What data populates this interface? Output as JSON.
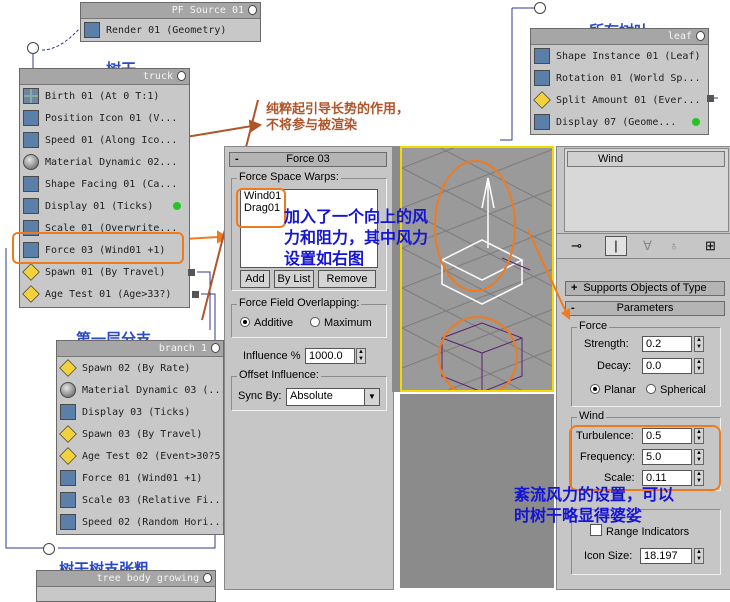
{
  "pf_source": {
    "header": "PF Source 01",
    "ops": [
      "Render 01 (Geometry)"
    ]
  },
  "truck": {
    "title": "树干",
    "header": "truck",
    "ops": [
      {
        "icon": "birth-icon",
        "label": "Birth 01 (At 0 T:1)"
      },
      {
        "icon": "position-icon",
        "label": "Position Icon 01 (V..."
      },
      {
        "icon": "speed-icon",
        "label": "Speed 01 (Along Ico..."
      },
      {
        "icon": "material-icon",
        "label": "Material Dynamic 02..."
      },
      {
        "icon": "shape-facing-icon",
        "label": "Shape Facing 01 (Ca..."
      },
      {
        "icon": "display-icon",
        "label": "Display 01 (Ticks)"
      },
      {
        "icon": "scale-icon",
        "label": "Scale 01 (Overwrite..."
      },
      {
        "icon": "force-icon",
        "label": "Force 03 (Wind01 +1)"
      },
      {
        "icon": "spawn-icon",
        "label": "Spawn 01 (By Travel)"
      },
      {
        "icon": "age-test-icon",
        "label": "Age Test 01 (Age>33?)"
      }
    ]
  },
  "leaf": {
    "title": "所有树叶",
    "header": "leaf",
    "ops": [
      {
        "icon": "shape-instance-icon",
        "label": "Shape Instance 01 (Leaf)"
      },
      {
        "icon": "rotation-icon",
        "label": "Rotation 01 (World Sp..."
      },
      {
        "icon": "split-amount-icon",
        "label": "Split Amount 01 (Ever..."
      },
      {
        "icon": "display-icon",
        "label": "Display 07 (Geome..."
      }
    ]
  },
  "branch": {
    "title": "第一层分支",
    "header": "branch 1",
    "ops": [
      {
        "icon": "spawn-icon",
        "label": "Spawn 02 (By Rate)"
      },
      {
        "icon": "material-icon",
        "label": "Material Dynamic 03 (..."
      },
      {
        "icon": "display-icon",
        "label": "Display 03 (Ticks)"
      },
      {
        "icon": "spawn-icon",
        "label": "Spawn 03 (By Travel)"
      },
      {
        "icon": "age-test-icon",
        "label": "Age Test 02 (Event>30?5..."
      },
      {
        "icon": "force-icon",
        "label": "Force 01 (Wind01 +1)"
      },
      {
        "icon": "scale-icon",
        "label": "Scale 03 (Relative Fi..."
      },
      {
        "icon": "speed-icon",
        "label": "Speed 02 (Random Hori..."
      }
    ]
  },
  "tree_body": {
    "title": "树干树支张粗",
    "header": "tree body growing"
  },
  "force_panel": {
    "title": "Force 03",
    "group_warps": "Force Space Warps:",
    "warps": [
      "Wind01",
      "Drag01"
    ],
    "btn_add": "Add",
    "btn_by_list": "By List",
    "btn_remove": "Remove",
    "group_overlap": "Force Field Overlapping:",
    "opt_additive": "Additive",
    "opt_maximum": "Maximum",
    "influence_label": "Influence %",
    "influence_value": "1000.0",
    "group_offset": "Offset Influence:",
    "sync_label": "Sync By:",
    "sync_value": "Absolute"
  },
  "wind_panel": {
    "name": "Wind",
    "roll_supports": "Supports Objects of Type",
    "roll_params": "Parameters",
    "group_force": "Force",
    "strength_label": "Strength:",
    "strength_value": "0.2",
    "decay_label": "Decay:",
    "decay_value": "0.0",
    "opt_planar": "Planar",
    "opt_spherical": "Spherical",
    "group_wind": "Wind",
    "turbulence_label": "Turbulence:",
    "turbulence_value": "0.5",
    "frequency_label": "Frequency:",
    "frequency_value": "5.0",
    "scale_label": "Scale:",
    "scale_value": "0.11",
    "range_label": "Range Indicators",
    "icon_size_label": "Icon Size:",
    "icon_size_value": "18.197"
  },
  "annotations": {
    "brown": "纯粹起引导长势的作用，\n不将参与被渲染",
    "force_note": "加入了一个向上的风\n力和阻力，其中风力\n设置如右图",
    "wind_note": "紊流风力的设置，可以\n时树干略显得婆娑"
  },
  "colors": {
    "annotation_orange": "#f07a1e",
    "annotation_blue": "#1414d6",
    "viewport_active": "#f5d800",
    "brown_text": "#b0542a"
  }
}
